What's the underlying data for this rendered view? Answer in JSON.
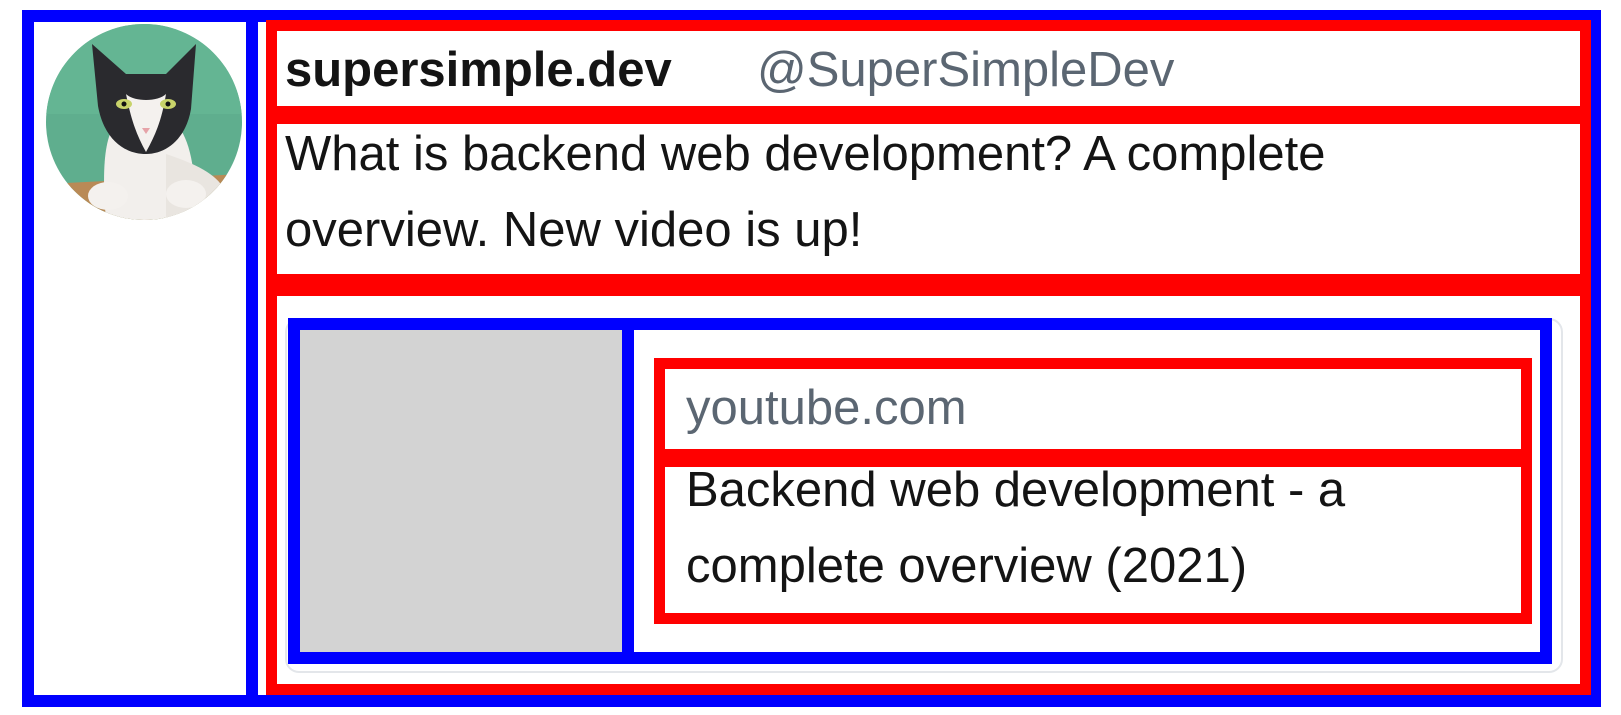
{
  "tweet": {
    "author_name": "supersimple.dev",
    "author_handle": "@SuperSimpleDev",
    "text_lines": [
      "What is backend web development? A complete",
      "overview. New video is up!"
    ],
    "avatar_icon": "cat-photo-avatar"
  },
  "link_preview": {
    "site": "youtube.com",
    "title_lines": [
      "Backend web development - a",
      "complete overview (2021)"
    ],
    "thumbnail_icon": "thumbnail-placeholder"
  },
  "colors": {
    "outline_blue": "#0000ff",
    "outline_red": "#ff0000",
    "secondary_text": "#5b6672",
    "thumbnail_fill": "#d3d3d3"
  }
}
